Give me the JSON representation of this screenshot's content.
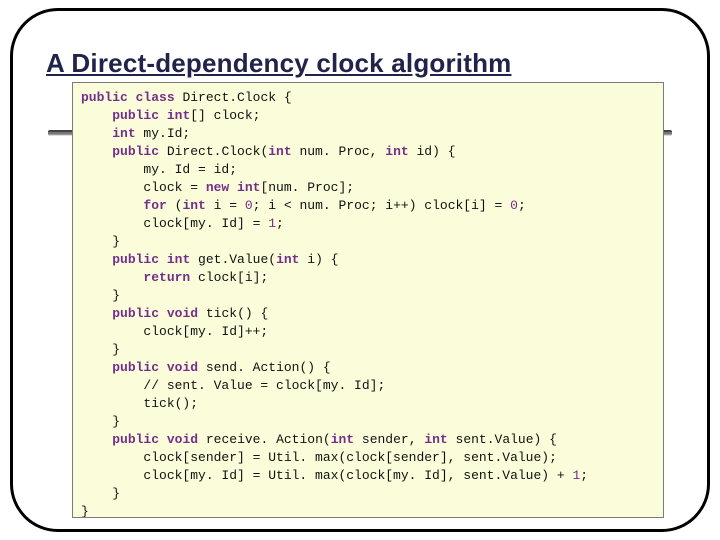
{
  "title": "A Direct-dependency clock algorithm",
  "code": {
    "l01a": "public",
    "l01b": " ",
    "l01c": "class",
    "l01d": " Direct.Clock {",
    "l02a": "    ",
    "l02b": "public",
    "l02c": " ",
    "l02d": "int",
    "l02e": "[] clock;",
    "l03a": "    ",
    "l03b": "int",
    "l03c": " my.Id;",
    "l04a": "    ",
    "l04b": "public",
    "l04c": " Direct.Clock(",
    "l04d": "int",
    "l04e": " num. Proc, ",
    "l04f": "int",
    "l04g": " id) {",
    "l05": "        my. Id = id;",
    "l06a": "        clock = ",
    "l06b": "new",
    "l06c": " ",
    "l06d": "int",
    "l06e": "[num. Proc];",
    "l07a": "        ",
    "l07b": "for",
    "l07c": " (",
    "l07d": "int",
    "l07e": " i = ",
    "l07f": "0",
    "l07g": "; i < num. Proc; i++) clock[i] = ",
    "l07h": "0",
    "l07i": ";",
    "l08a": "        clock[my. Id] = ",
    "l08b": "1",
    "l08c": ";",
    "l09": "    }",
    "l10a": "    ",
    "l10b": "public",
    "l10c": " ",
    "l10d": "int",
    "l10e": " get.Value(",
    "l10f": "int",
    "l10g": " i) {",
    "l11a": "        ",
    "l11b": "return",
    "l11c": " clock[i];",
    "l12": "    }",
    "l13a": "    ",
    "l13b": "public",
    "l13c": " ",
    "l13d": "void",
    "l13e": " tick() {",
    "l14": "        clock[my. Id]++;",
    "l15": "    }",
    "l16a": "    ",
    "l16b": "public",
    "l16c": " ",
    "l16d": "void",
    "l16e": " send. Action() {",
    "l17": "        // sent. Value = clock[my. Id];",
    "l18": "        tick();",
    "l19": "    }",
    "l20a": "    ",
    "l20b": "public",
    "l20c": " ",
    "l20d": "void",
    "l20e": " receive. Action(",
    "l20f": "int",
    "l20g": " sender, ",
    "l20h": "int",
    "l20i": " sent.Value) {",
    "l21": "        clock[sender] = Util. max(clock[sender], sent.Value);",
    "l22a": "        clock[my. Id] = Util. max(clock[my. Id], sent.Value) + ",
    "l22b": "1",
    "l22c": ";",
    "l23": "    }",
    "l24": "}"
  }
}
